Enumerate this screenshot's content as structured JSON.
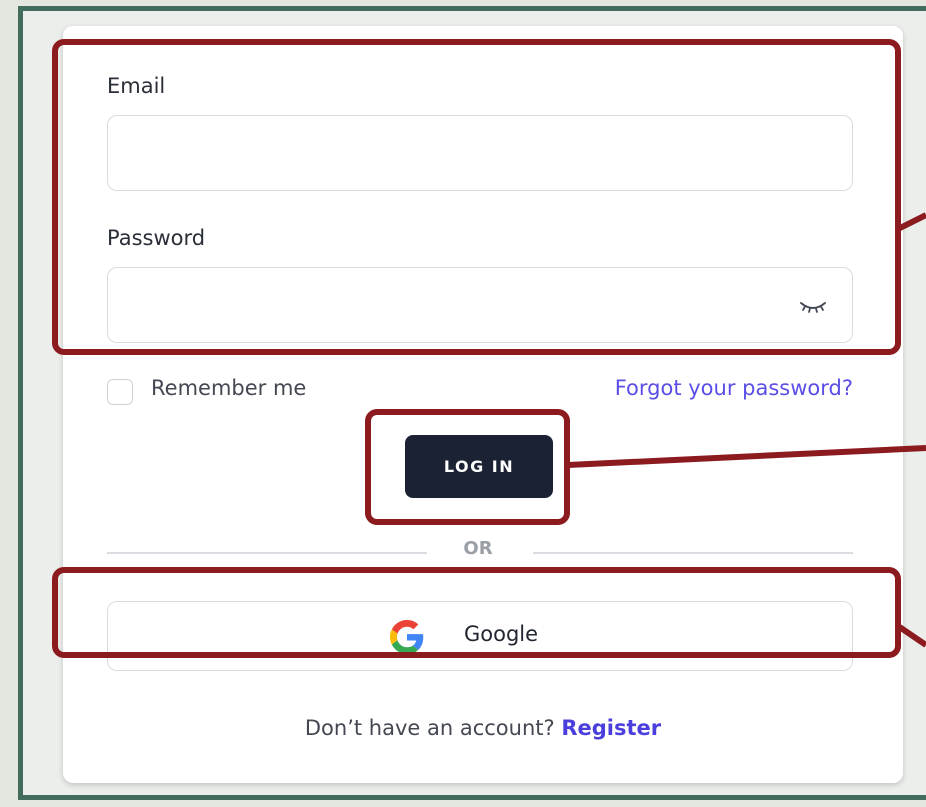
{
  "form": {
    "email_label": "Email",
    "email_value": "",
    "email_placeholder": "",
    "password_label": "Password",
    "password_value": "",
    "password_placeholder": "",
    "remember_label": "Remember me",
    "remember_checked": false,
    "forgot_label": "Forgot your password?",
    "login_label": "LOG IN",
    "divider_label": "OR",
    "google_label": "Google",
    "register_prompt": "Don’t have an account?",
    "register_label": "Register"
  },
  "icons": {
    "password_toggle": "eye-closed-icon",
    "google": "google-g-icon"
  },
  "colors": {
    "outer_border": "#436c5e",
    "page_background": "#e4e6e0",
    "card_background": "#ffffff",
    "primary_button": "#1b2233",
    "link": "#5b4ee6",
    "annotation": "#8c1b1f"
  }
}
